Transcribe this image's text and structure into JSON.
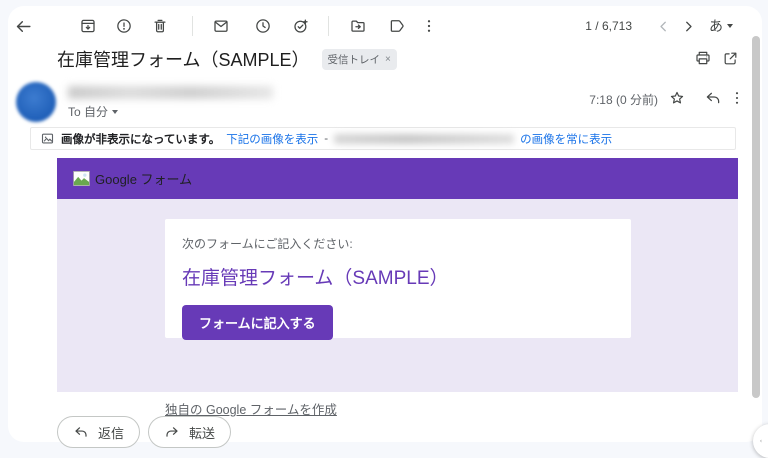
{
  "colors": {
    "accent_purple": "#673ab7",
    "email_body_purple": "#ebe7f5",
    "link_blue": "#1a73e8",
    "avatar_blue": "#2b6cc8",
    "toolbar_icon_gray": "#444746"
  },
  "toolbar": {
    "pagination": "1 / 6,713",
    "input_tool_label": "あ",
    "icons": [
      "back-arrow",
      "archive",
      "report-spam",
      "delete",
      "mark-unread",
      "snooze",
      "add-to-tasks",
      "move-to",
      "labels",
      "more-vert",
      "chevron-left",
      "chevron-right",
      "input-tools"
    ]
  },
  "subject": {
    "title": "在庫管理フォーム（SAMPLE）",
    "label_chip": "受信トレイ",
    "label_close": "×",
    "icons": [
      "print",
      "open-in-new"
    ]
  },
  "sender": {
    "to_label": "To 自分",
    "timestamp": "7:18 (0 分前)",
    "icons": [
      "star",
      "reply",
      "more-vert"
    ]
  },
  "banner": {
    "message": "画像が非表示になっています。",
    "show_images_link": "下記の画像を表示",
    "separator": "-",
    "always_show_link": "の画像を常に表示",
    "icons": [
      "hidden-image"
    ]
  },
  "email": {
    "header_brand": "Google フォーム",
    "intro": "次のフォームにご記入ください:",
    "form_title": "在庫管理フォーム（SAMPLE）",
    "cta_button": "フォームに記入する",
    "footer_link": "独自の Google フォームを作成",
    "icons": [
      "broken-image"
    ]
  },
  "actions": {
    "reply": "返信",
    "forward": "転送"
  },
  "side_panel": {
    "icons": [
      "chevron-left"
    ]
  }
}
